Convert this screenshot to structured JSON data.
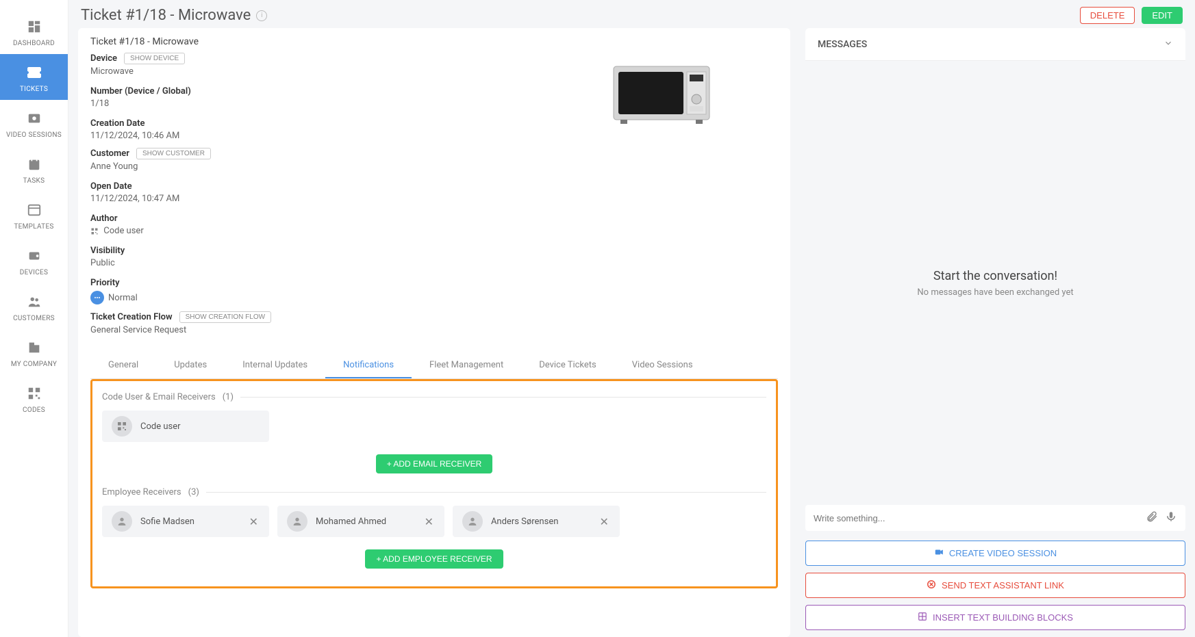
{
  "sidebar": {
    "items": [
      {
        "label": "DASHBOARD"
      },
      {
        "label": "TICKETS"
      },
      {
        "label": "VIDEO SESSIONS"
      },
      {
        "label": "TASKS"
      },
      {
        "label": "TEMPLATES"
      },
      {
        "label": "DEVICES"
      },
      {
        "label": "CUSTOMERS"
      },
      {
        "label": "MY COMPANY"
      },
      {
        "label": "CODES"
      }
    ]
  },
  "header": {
    "title": "Ticket #1/18 - Microwave",
    "delete": "DELETE",
    "edit": "EDIT"
  },
  "ticket": {
    "subtitle": "Ticket #1/18 - Microwave",
    "device_label": "Device",
    "show_device": "SHOW DEVICE",
    "device_value": "Microwave",
    "number_label": "Number (Device / Global)",
    "number_value": "1/18",
    "creation_label": "Creation Date",
    "creation_value": "11/12/2024, 10:46 AM",
    "customer_label": "Customer",
    "show_customer": "SHOW CUSTOMER",
    "customer_value": "Anne Young",
    "open_label": "Open Date",
    "open_value": "11/12/2024, 10:47 AM",
    "author_label": "Author",
    "author_value": "Code user",
    "visibility_label": "Visibility",
    "visibility_value": "Public",
    "priority_label": "Priority",
    "priority_value": "Normal",
    "flow_label": "Ticket Creation Flow",
    "show_flow": "SHOW CREATION FLOW",
    "flow_value": "General Service Request"
  },
  "tabs": [
    {
      "label": "General"
    },
    {
      "label": "Updates"
    },
    {
      "label": "Internal Updates"
    },
    {
      "label": "Notifications"
    },
    {
      "label": "Fleet Management"
    },
    {
      "label": "Device Tickets"
    },
    {
      "label": "Video Sessions"
    }
  ],
  "notifications": {
    "code_user_header": "Code User & Email Receivers",
    "code_user_count": "(1)",
    "code_user_name": "Code user",
    "add_email": "+ ADD EMAIL RECEIVER",
    "employee_header": "Employee Receivers",
    "employee_count": "(3)",
    "employees": [
      {
        "name": "Sofie Madsen"
      },
      {
        "name": "Mohamed Ahmed"
      },
      {
        "name": "Anders Sørensen"
      }
    ],
    "add_employee": "+ ADD EMPLOYEE RECEIVER"
  },
  "messages": {
    "title": "MESSAGES",
    "start_title": "Start the conversation!",
    "start_sub": "No messages have been exchanged yet",
    "placeholder": "Write something...",
    "video_btn": "CREATE VIDEO SESSION",
    "text_btn": "SEND TEXT ASSISTANT LINK",
    "blocks_btn": "INSERT TEXT BUILDING BLOCKS"
  }
}
